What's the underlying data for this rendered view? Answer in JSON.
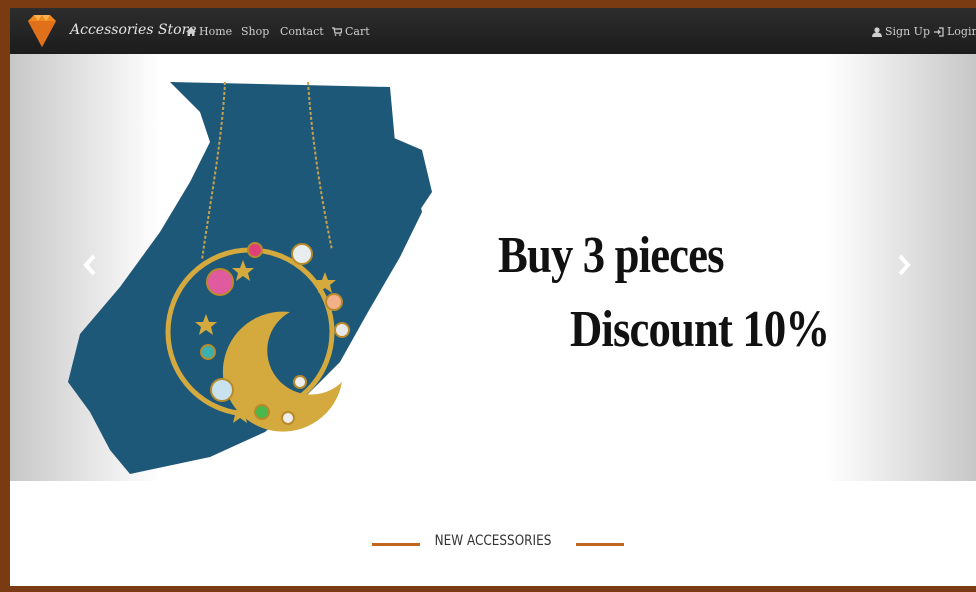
{
  "navbar": {
    "brand": "Accessories Store",
    "home": "Home",
    "shop": "Shop",
    "contact": "Contact",
    "cart": "Cart",
    "signup": "Sign Up",
    "login": "Login"
  },
  "carousel": {
    "line1": "Buy 3 pieces",
    "line2": "Discount 10%"
  },
  "section": {
    "title": "NEW ACCESSORIES"
  },
  "colors": {
    "frame": "#7a3a12",
    "navbar": "#222222",
    "brush": "#1e5878",
    "accent_line": "#c0661e",
    "logo": "#f08a1c"
  }
}
